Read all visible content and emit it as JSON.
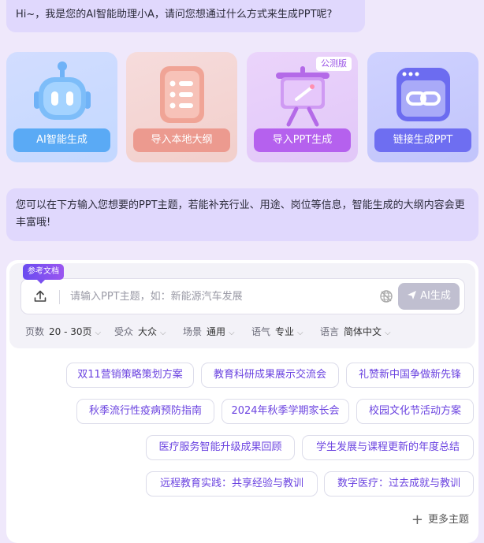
{
  "greeting": "Hi~，我是您的AI智能助理小A，请问您想通过什么方式来生成PPT呢?",
  "cards": [
    {
      "label": "AI智能生成"
    },
    {
      "label": "导入本地大纲"
    },
    {
      "label": "导入PPT生成",
      "badge": "公测版"
    },
    {
      "label": "链接生成PPT"
    }
  ],
  "hint": "您可以在下方输入您想要的PPT主题，若能补充行业、用途、岗位等信息，智能生成的大纲内容会更丰富哦!",
  "input": {
    "ref_tag": "参考文档",
    "placeholder": "请输入PPT主题，如：新能源汽车发展",
    "generate_label": "AI生成"
  },
  "options": [
    {
      "label": "页数",
      "value": "20 - 30页"
    },
    {
      "label": "受众",
      "value": "大众"
    },
    {
      "label": "场景",
      "value": "通用"
    },
    {
      "label": "语气",
      "value": "专业"
    },
    {
      "label": "语言",
      "value": "简体中文"
    }
  ],
  "topics": [
    "双11营销策略策划方案",
    "教育科研成果展示交流会",
    "礼赞新中国争做新先锋",
    "秋季流行性疫病预防指南",
    "2024年秋季学期家长会",
    "校园文化节活动方案",
    "医疗服务智能升级成果回顾",
    "学生发展与课程更新的年度总结",
    "远程教育实践：共享经验与教训",
    "数字医疗：过去成就与教训"
  ],
  "more_label": "更多主题",
  "colors": {
    "accent": "#6b43e0",
    "bubble": "#e0d8fd"
  }
}
